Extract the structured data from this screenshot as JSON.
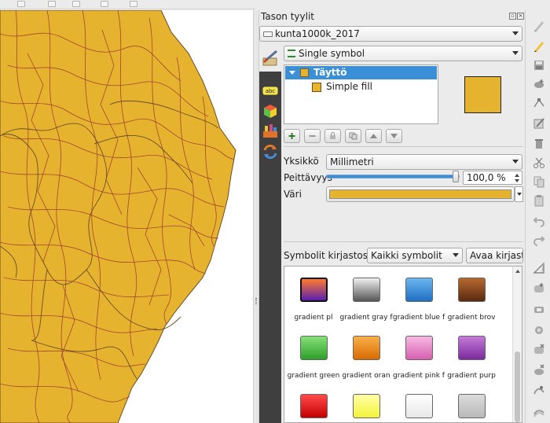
{
  "dock": {
    "title": "Tason tyylit",
    "layer_name": "kunta1000k_2017",
    "renderer": "Single symbol"
  },
  "symbol_tree": {
    "fill_label": "Täyttö",
    "layer_label": "Simple fill"
  },
  "properties": {
    "unit_label": "Yksikkö",
    "unit_value": "Millimetri",
    "opacity_label": "Peittävyys",
    "opacity_value": "100,0 %",
    "opacity_fraction": 1.0,
    "color_label": "Väri"
  },
  "library": {
    "label": "Symbolit kirjastossa",
    "filter": "Kaikki symbolit",
    "open_button": "Avaa kirjasto",
    "symbols": [
      {
        "name": "gradient  pl",
        "top": "#ff7a2e",
        "bottom": "#5a1fb0",
        "selected": true
      },
      {
        "name": "gradient  gray f",
        "top": "#f0f0f0",
        "bottom": "#555555"
      },
      {
        "name": "gradient blue f",
        "top": "#6bb6ef",
        "bottom": "#1f6fc4"
      },
      {
        "name": "gradient brov",
        "top": "#b5682f",
        "bottom": "#5a2a10"
      },
      {
        "name": "gradient green",
        "top": "#86e07a",
        "bottom": "#2e9e2a"
      },
      {
        "name": "gradient oran",
        "top": "#f8b04a",
        "bottom": "#d86b00"
      },
      {
        "name": "gradient pink f",
        "top": "#f6b9e3",
        "bottom": "#d65fb0"
      },
      {
        "name": "gradient purp",
        "top": "#c57ad6",
        "bottom": "#7a2a9e"
      },
      {
        "name": "",
        "top": "#ff4a4a",
        "bottom": "#c40000"
      },
      {
        "name": "",
        "top": "#ffffa8",
        "bottom": "#f3f33a"
      },
      {
        "name": "",
        "top": "#ffffff",
        "bottom": "#e8e8e8"
      },
      {
        "name": "",
        "top": "#dcdcdc",
        "bottom": "#b8b8b8"
      }
    ]
  },
  "colors": {
    "fill": "#e6b32e",
    "boundary": "#6a4d2a",
    "road": "#a3462f",
    "selection": "#3a8fd6"
  }
}
